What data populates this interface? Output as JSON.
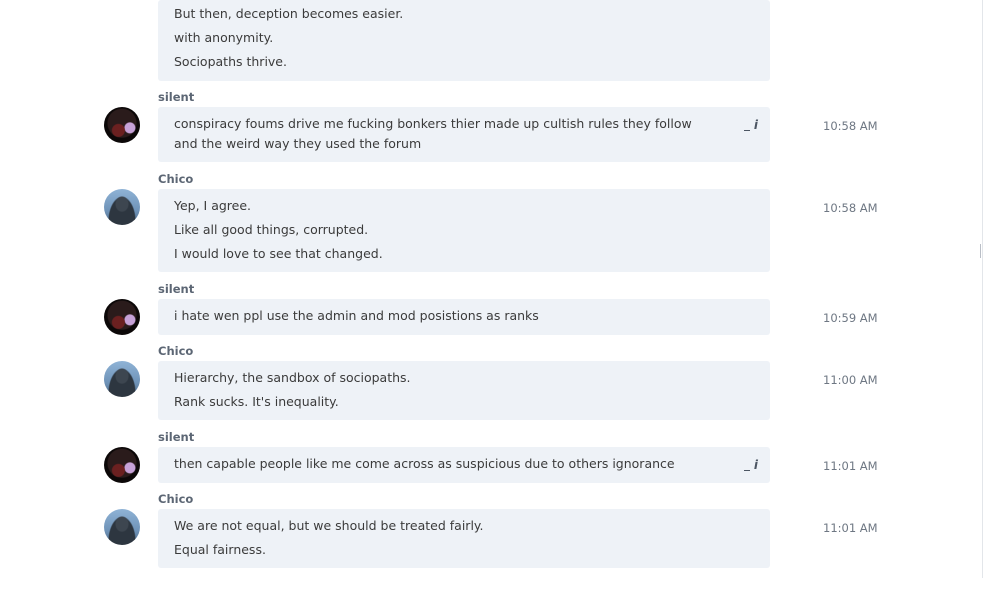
{
  "messages": [
    {
      "sender": "",
      "time": "",
      "lines": [
        "But then, deception becomes easier.",
        "with anonymity.",
        "Sociopaths thrive."
      ]
    },
    {
      "sender": "silent",
      "time": "10:58 AM",
      "lines": [
        "conspiracy foums drive me fucking bonkers thier made up cultish rules they follow and the weird way they used the forum"
      ],
      "edited_icon": "i"
    },
    {
      "sender": "Chico",
      "time": "10:58 AM",
      "lines": [
        "Yep, I agree.",
        "Like all good things, corrupted.",
        "I would love to see that changed."
      ]
    },
    {
      "sender": "silent",
      "time": "10:59 AM",
      "lines": [
        "i hate wen ppl use the admin and mod  posistions  as ranks"
      ]
    },
    {
      "sender": "Chico",
      "time": "11:00 AM",
      "lines": [
        "Hierarchy, the sandbox of sociopaths.",
        "Rank sucks.  It's inequality."
      ]
    },
    {
      "sender": "silent",
      "time": "11:01 AM",
      "lines": [
        "then capable people like me come across as suspicious  due to others ignorance"
      ],
      "edited_icon": "i"
    },
    {
      "sender": "Chico",
      "time": "11:01 AM",
      "lines": [
        "We are not equal, but we should be treated fairly.",
        "Equal fairness."
      ]
    }
  ],
  "icons": {
    "avatar_silent": "avatar-dark-portrait",
    "avatar_chico": "avatar-person-photo",
    "edit_icon": "edit-italic-i-icon"
  },
  "colors": {
    "bubble": "#eef2f7",
    "sender_name": "#5c6674",
    "timestamp": "#6e7783"
  }
}
